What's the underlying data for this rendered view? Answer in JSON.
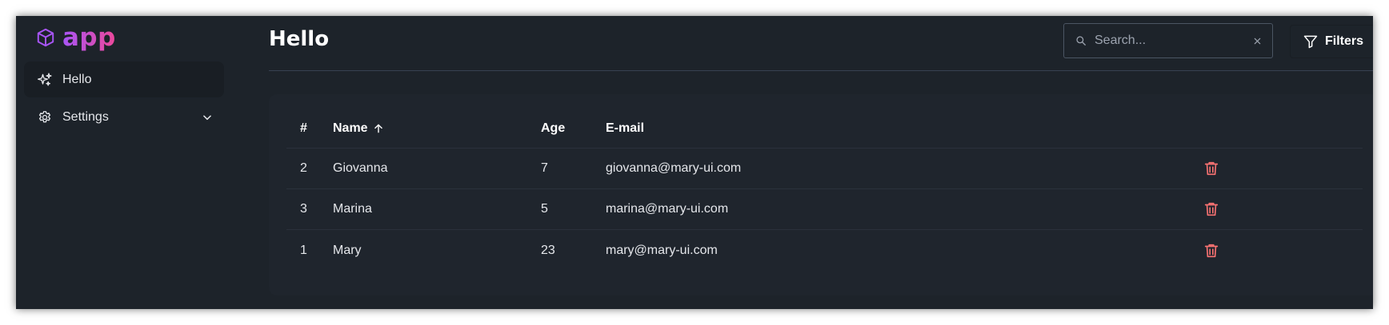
{
  "app": {
    "brand": "app",
    "colors": {
      "brand_from": "#a855f7",
      "brand_to": "#ec4899",
      "danger": "#f87272",
      "background": "#1d232a"
    }
  },
  "sidebar": {
    "items": [
      {
        "label": "Hello",
        "icon": "sparkles-icon",
        "active": true
      },
      {
        "label": "Settings",
        "icon": "gear-icon",
        "expandable": true
      }
    ]
  },
  "header": {
    "title": "Hello",
    "search": {
      "placeholder": "Search...",
      "value": ""
    },
    "filters_label": "Filters"
  },
  "table": {
    "columns": [
      "#",
      "Name",
      "Age",
      "E-mail"
    ],
    "sort": {
      "column": "Name",
      "direction": "asc"
    },
    "rows": [
      {
        "id": "2",
        "name": "Giovanna",
        "age": "7",
        "email": "giovanna@mary-ui.com"
      },
      {
        "id": "3",
        "name": "Marina",
        "age": "5",
        "email": "marina@mary-ui.com"
      },
      {
        "id": "1",
        "name": "Mary",
        "age": "23",
        "email": "mary@mary-ui.com"
      }
    ]
  }
}
